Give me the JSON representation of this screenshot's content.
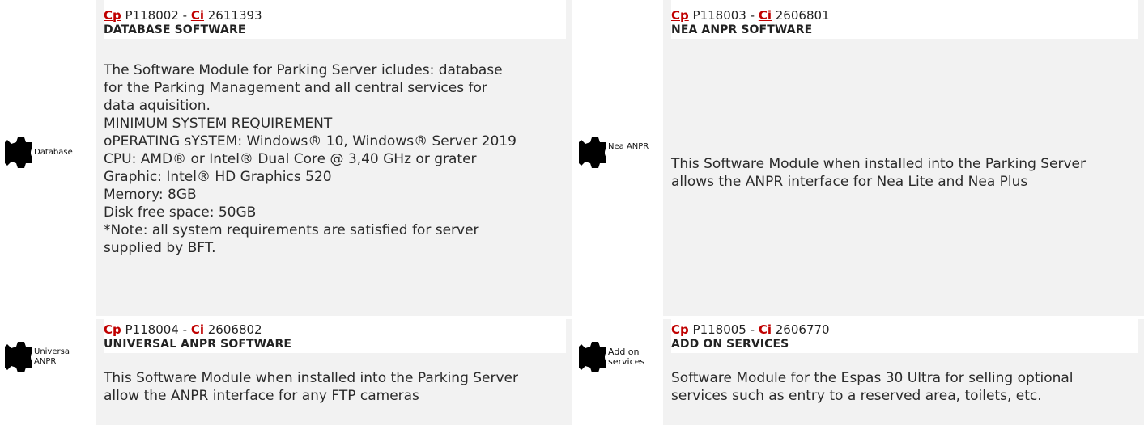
{
  "products": [
    {
      "cp_label": "Cp",
      "cp_code": "P118002",
      "separator": "-",
      "ci_label": "Ci",
      "ci_code": "2611393",
      "title": "DATABASE SOFTWARE",
      "icon_name": "gear-icon",
      "icon_label": "Database",
      "description_lines": [
        "The Software Module for Parking Server icludes: database",
        "for the Parking Management and all central services for",
        "data aquisition.",
        "MINIMUM SYSTEM REQUIREMENT",
        "oPERATING sYSTEM: Windows® 10, Windows® Server 2019",
        "CPU: AMD® or Intel® Dual Core @ 3,40 GHz or grater",
        "Graphic: Intel® HD Graphics 520",
        "Memory: 8GB",
        "Disk free space: 50GB",
        "*Note: all system requirements are satisfied for server",
        "supplied by BFT."
      ]
    },
    {
      "cp_label": "Cp",
      "cp_code": "P118003",
      "separator": "-",
      "ci_label": "Ci",
      "ci_code": "2606801",
      "title": "NEA ANPR SOFTWARE",
      "icon_name": "gear-icon",
      "icon_label": "Nea ANPR",
      "description_lines": [
        "This Software Module when installed into the Parking Server",
        "allows the ANPR interface for Nea Lite and Nea Plus"
      ]
    },
    {
      "cp_label": "Cp",
      "cp_code": "P118004",
      "separator": "-",
      "ci_label": "Ci",
      "ci_code": "2606802",
      "title": "UNIVERSAL ANPR SOFTWARE",
      "icon_name": "gear-icon",
      "icon_label_line1": "Universa",
      "icon_label_line2": "ANPR",
      "description_lines": [
        "This Software Module when installed into the Parking Server",
        "allow the ANPR interface for any FTP cameras"
      ]
    },
    {
      "cp_label": "Cp",
      "cp_code": "P118005",
      "separator": "-",
      "ci_label": "Ci",
      "ci_code": "2606770",
      "title": "ADD ON SERVICES",
      "icon_name": "gear-icon",
      "icon_label_line1": "Add on",
      "icon_label_line2": "services",
      "description_lines": [
        "Software Module for the Espas 30 Ultra for selling optional",
        "services such as entry to a reserved area, toilets, etc."
      ]
    }
  ],
  "colors": {
    "tag_link": "#c00000",
    "cell_background": "#f2f2f2",
    "header_background": "#ffffff"
  }
}
